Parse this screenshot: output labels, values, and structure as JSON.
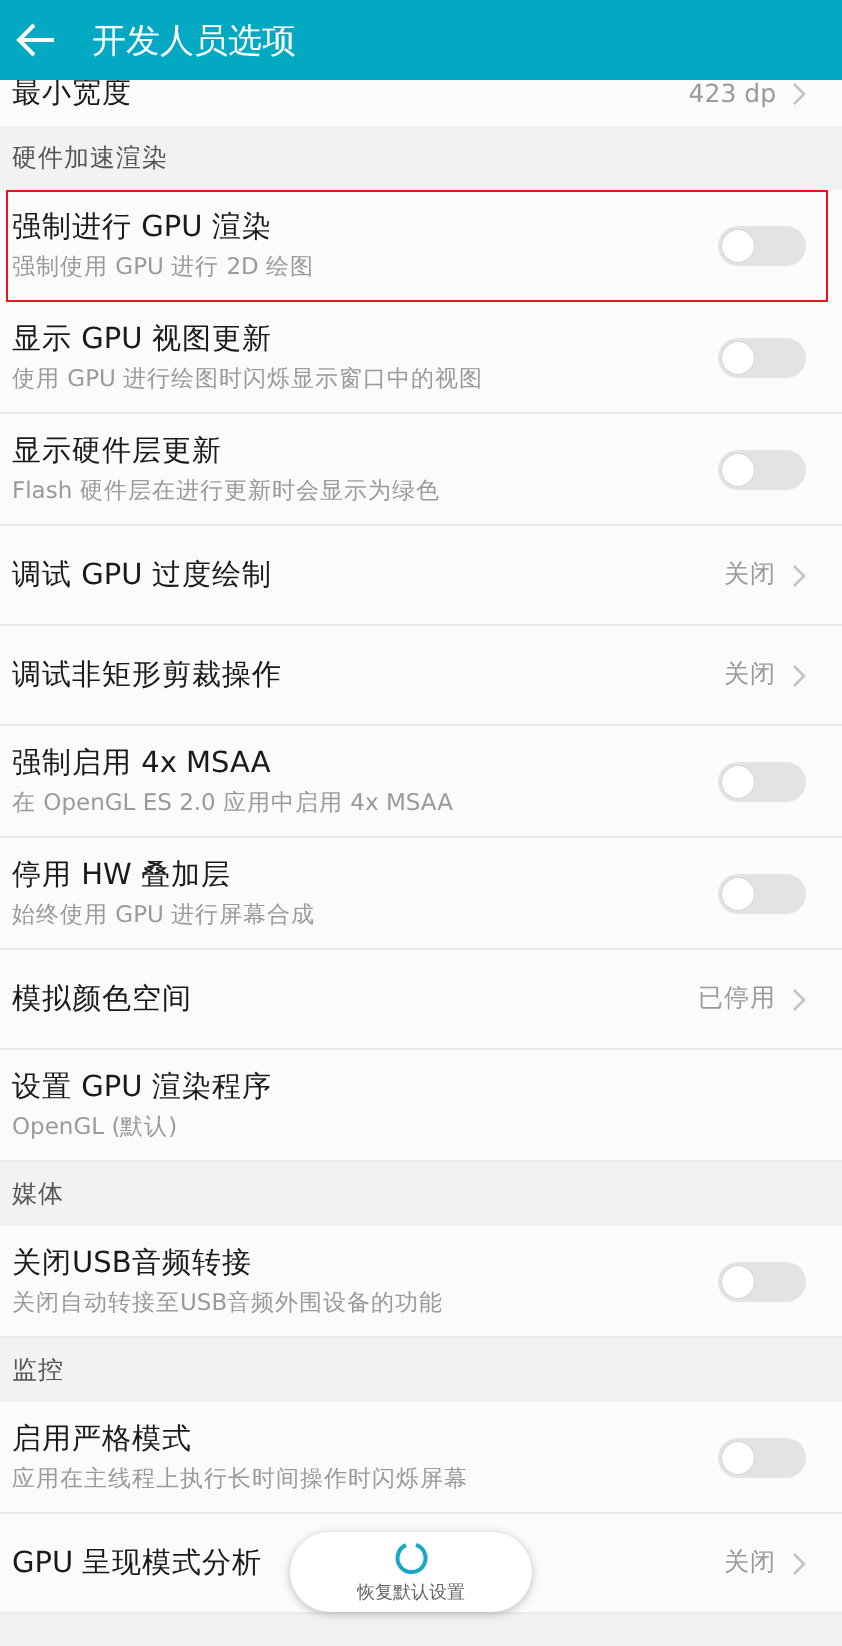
{
  "app_bar": {
    "title": "开发人员选项"
  },
  "top_row": {
    "title": "最小宽度",
    "value": "423 dp"
  },
  "sections": [
    {
      "header": "硬件加速渲染",
      "items": [
        {
          "kind": "toggle",
          "title": "强制进行 GPU 渲染",
          "summary": "强制使用 GPU 进行 2D 绘图",
          "on": false,
          "highlighted": true
        },
        {
          "kind": "toggle",
          "title": "显示 GPU 视图更新",
          "summary": "使用 GPU 进行绘图时闪烁显示窗口中的视图",
          "on": false,
          "highlighted": false
        },
        {
          "kind": "toggle",
          "title": "显示硬件层更新",
          "summary": "Flash 硬件层在进行更新时会显示为绿色",
          "on": false,
          "highlighted": false
        },
        {
          "kind": "value",
          "title": "调试 GPU 过度绘制",
          "value": "关闭",
          "highlighted": false
        },
        {
          "kind": "value",
          "title": "调试非矩形剪裁操作",
          "value": "关闭",
          "highlighted": false
        },
        {
          "kind": "toggle",
          "title": "强制启用 4x MSAA",
          "summary": "在 OpenGL ES 2.0 应用中启用 4x MSAA",
          "on": false,
          "highlighted": false
        },
        {
          "kind": "toggle",
          "title": "停用 HW 叠加层",
          "summary": "始终使用 GPU 进行屏幕合成",
          "on": false,
          "highlighted": false
        },
        {
          "kind": "value",
          "title": "模拟颜色空间",
          "value": "已停用",
          "highlighted": false
        },
        {
          "kind": "text",
          "title": "设置 GPU 渲染程序",
          "summary": "OpenGL (默认)",
          "highlighted": false
        }
      ]
    },
    {
      "header": "媒体",
      "items": [
        {
          "kind": "toggle",
          "title": "关闭USB音频转接",
          "summary": "关闭自动转接至USB音频外围设备的功能",
          "on": false,
          "highlighted": false
        }
      ]
    },
    {
      "header": "监控",
      "items": [
        {
          "kind": "toggle",
          "title": "启用严格模式",
          "summary": "应用在主线程上执行长时间操作时闪烁屏幕",
          "on": false,
          "highlighted": false
        },
        {
          "kind": "value",
          "title": "GPU 呈现模式分析",
          "value": "关闭",
          "highlighted": false
        }
      ]
    }
  ],
  "restore_button": {
    "label": "恢复默认设置"
  }
}
